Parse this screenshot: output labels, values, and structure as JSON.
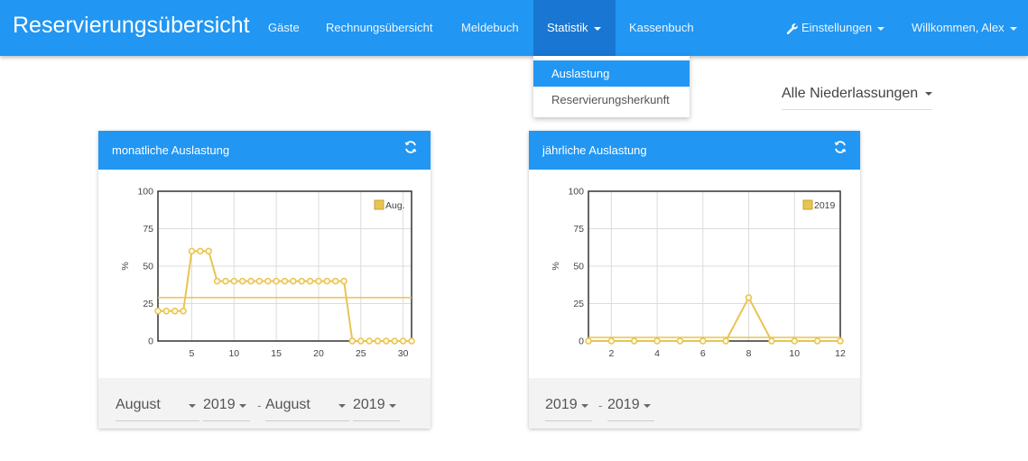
{
  "navbar": {
    "brand": "Reservierungsübersicht",
    "items": [
      "Gäste",
      "Rechnungsübersicht",
      "Meldebuch",
      "Statistik",
      "Kassenbuch"
    ],
    "settings": "Einstellungen",
    "user": "Willkommen, Alex"
  },
  "dropdown": {
    "items": [
      "Auslastung",
      "Reservierungsherkunft"
    ]
  },
  "branch_select": "Alle Niederlassungen",
  "monthly": {
    "title": "monatliche Auslastung",
    "from_month": "August",
    "from_year": "2019",
    "separator": "-",
    "to_month": "August",
    "to_year": "2019"
  },
  "yearly": {
    "title": "jährliche Auslastung",
    "from_year": "2019",
    "separator": "-",
    "to_year": "2019"
  },
  "colors": {
    "primary": "#2196f3",
    "primary_dark": "#1976d2",
    "series": "#e8c452"
  },
  "chart_data": [
    {
      "type": "line",
      "title": "monatliche Auslastung",
      "ylabel": "%",
      "ylim": [
        0,
        100
      ],
      "yticks": [
        0,
        25,
        50,
        75,
        100
      ],
      "xlim": [
        1,
        31
      ],
      "xticks": [
        5,
        10,
        15,
        20,
        25,
        30
      ],
      "legend": "top-right",
      "grid": true,
      "series": [
        {
          "name": "Aug.",
          "x": [
            1,
            2,
            3,
            4,
            5,
            6,
            7,
            8,
            9,
            10,
            11,
            12,
            13,
            14,
            15,
            16,
            17,
            18,
            19,
            20,
            21,
            22,
            23,
            24,
            25,
            26,
            27,
            28,
            29,
            30,
            31
          ],
          "values": [
            20,
            20,
            20,
            20,
            60,
            60,
            60,
            40,
            40,
            40,
            40,
            40,
            40,
            40,
            40,
            40,
            40,
            40,
            40,
            40,
            40,
            40,
            40,
            0,
            0,
            0,
            0,
            0,
            0,
            0,
            0
          ]
        }
      ],
      "average": 29
    },
    {
      "type": "line",
      "title": "jährliche Auslastung",
      "ylabel": "%",
      "ylim": [
        0,
        100
      ],
      "yticks": [
        0,
        25,
        50,
        75,
        100
      ],
      "xlim": [
        1,
        12
      ],
      "xticks": [
        2,
        4,
        6,
        8,
        10,
        12
      ],
      "legend": "top-right",
      "grid": true,
      "series": [
        {
          "name": "2019",
          "x": [
            1,
            2,
            3,
            4,
            5,
            6,
            7,
            8,
            9,
            10,
            11,
            12
          ],
          "values": [
            0,
            0,
            0,
            0,
            0,
            0,
            0,
            29,
            0,
            0,
            0,
            0
          ]
        }
      ],
      "average": 2.4
    }
  ]
}
